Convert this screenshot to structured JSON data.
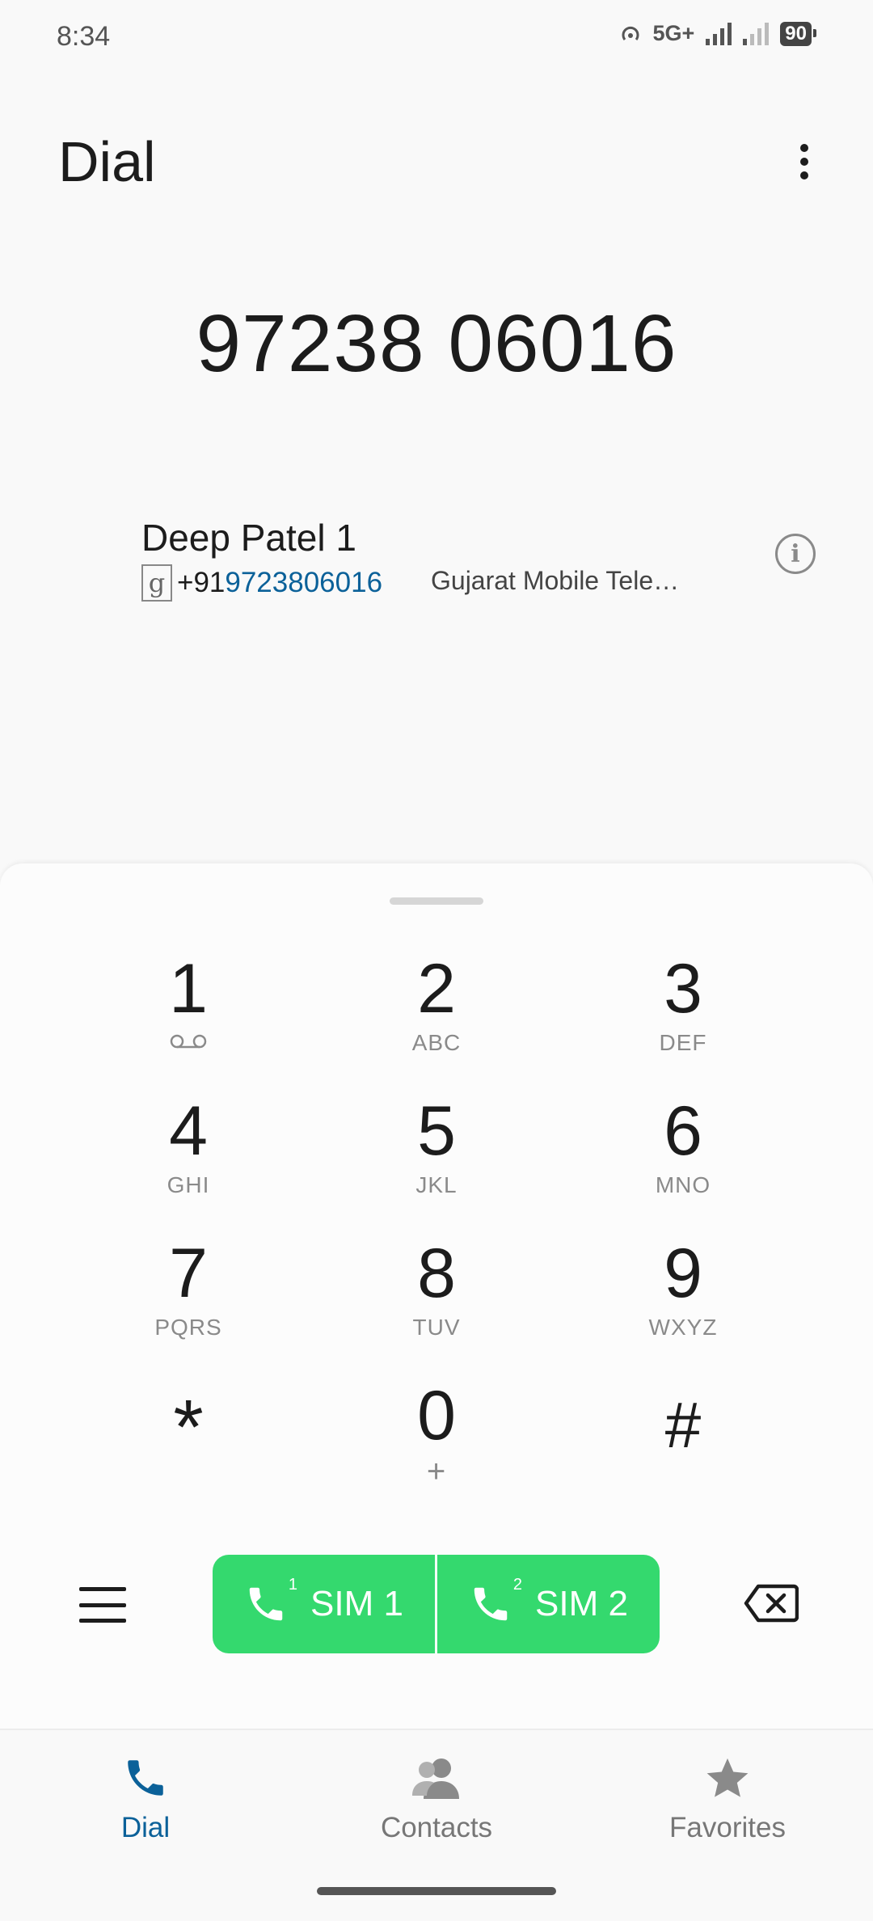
{
  "status_bar": {
    "time": "8:34",
    "network": "5G+",
    "battery": "90"
  },
  "header": {
    "title": "Dial"
  },
  "dialer": {
    "number": "97238 06016"
  },
  "suggestion": {
    "name": "Deep Patel 1",
    "source_badge": "g",
    "number_prefix": "+91",
    "number_match": "9723806016",
    "carrier": "Gujarat Mobile Tele…"
  },
  "keypad": {
    "keys": [
      {
        "digit": "1",
        "letters": ""
      },
      {
        "digit": "2",
        "letters": "ABC"
      },
      {
        "digit": "3",
        "letters": "DEF"
      },
      {
        "digit": "4",
        "letters": "GHI"
      },
      {
        "digit": "5",
        "letters": "JKL"
      },
      {
        "digit": "6",
        "letters": "MNO"
      },
      {
        "digit": "7",
        "letters": "PQRS"
      },
      {
        "digit": "8",
        "letters": "TUV"
      },
      {
        "digit": "9",
        "letters": "WXYZ"
      },
      {
        "digit": "*",
        "letters": ""
      },
      {
        "digit": "0",
        "letters": "+"
      },
      {
        "digit": "#",
        "letters": ""
      }
    ]
  },
  "actions": {
    "sim1_label": "SIM 1",
    "sim1_index": "1",
    "sim2_label": "SIM 2",
    "sim2_index": "2",
    "call_color": "#34d96e"
  },
  "bottom_nav": {
    "items": [
      {
        "label": "Dial",
        "icon": "phone-icon",
        "active": true
      },
      {
        "label": "Contacts",
        "icon": "contacts-icon",
        "active": false
      },
      {
        "label": "Favorites",
        "icon": "star-icon",
        "active": false
      }
    ],
    "active_color": "#0b6199"
  }
}
